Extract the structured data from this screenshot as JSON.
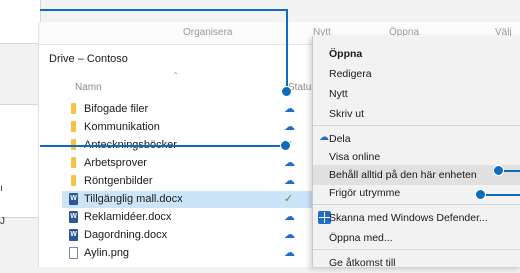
{
  "toolbar": {
    "organize_label": "Organisera",
    "new_label": "Nytt",
    "open_label": "Öppna",
    "select_label": "Välj"
  },
  "location": "Drive – Contoso",
  "columns": {
    "name": "Namn",
    "status": "Status"
  },
  "files": [
    {
      "name": "Bifogade filer",
      "type": "folder",
      "status": "cloud"
    },
    {
      "name": "Kommunikation",
      "type": "folder",
      "status": "cloud"
    },
    {
      "name": "Anteckningsböcker",
      "type": "folder",
      "status": "synced"
    },
    {
      "name": "Arbetsprover",
      "type": "folder",
      "status": "cloud"
    },
    {
      "name": "Röntgenbilder",
      "type": "folder",
      "status": "cloud"
    },
    {
      "name": "Tillgänglig mall.docx",
      "type": "docx",
      "status": "synced",
      "selected": true
    },
    {
      "name": "Reklamidéer.docx",
      "type": "docx",
      "status": "cloud"
    },
    {
      "name": "Dagordning.docx",
      "type": "docx",
      "status": "cloud"
    },
    {
      "name": "Aylin.png",
      "type": "png",
      "status": "cloud"
    }
  ],
  "icons": {
    "cloud": "☁",
    "synced": "✓"
  },
  "context_menu": {
    "items": [
      {
        "label": "Öppna",
        "bold": true
      },
      {
        "label": "Redigera"
      },
      {
        "label": "Nytt"
      },
      {
        "label": "Skriv ut"
      },
      {
        "label": "Dela",
        "icon": "cloud-icon"
      },
      {
        "label": "Visa online"
      },
      {
        "label": "Behåll alltid på den här enheten",
        "highlighted": true
      },
      {
        "label": "Frigör utrymme"
      },
      {
        "label": "Skanna med Windows Defender...",
        "icon": "defender-icon"
      },
      {
        "label": "Öppna med..."
      },
      {
        "label": "Ge åtkomst till"
      }
    ]
  },
  "colors": {
    "callout": "#0f6cbd",
    "status_cloud": "#1e6fc5",
    "status_synced": "#2e9d3a",
    "selection": "#cce4f7"
  }
}
